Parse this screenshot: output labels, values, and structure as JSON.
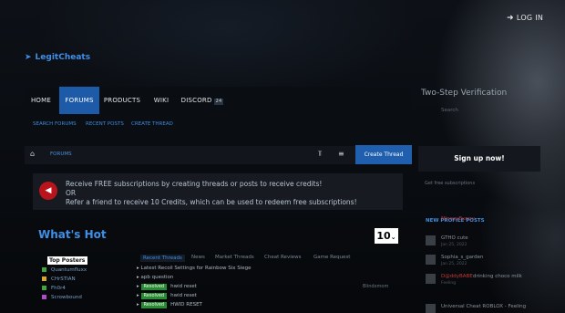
{
  "header": {
    "login_label": "LOG IN",
    "logo_text": "LegitCheats"
  },
  "nav": {
    "items": [
      {
        "label": "HOME"
      },
      {
        "label": "FORUMS"
      },
      {
        "label": "PRODUCTS"
      },
      {
        "label": "WIKI"
      },
      {
        "label": "DISCORD"
      }
    ],
    "discord_tag": "24",
    "active_index": 1
  },
  "subnav": {
    "search": "SEARCH FORUMS",
    "recent": "RECENT POSTS",
    "create": "CREATE THREAD"
  },
  "breadcrumb": {
    "forums": "FORUMS",
    "create_thread_button": "Create Thread"
  },
  "notice": {
    "line1": "Receive FREE subscriptions by creating threads or posts to receive credits!",
    "line2": "OR",
    "line3": "Refer a friend to receive 10 Credits, which can be used to redeem free subscriptions!"
  },
  "whats_hot": {
    "title": "What's Hot",
    "count_select": "10"
  },
  "top_posters": {
    "select_label": "Top Posters",
    "names": [
      "Quantumfluxx",
      "CHrSTIAN",
      "Fh0r4",
      "Scrowbound"
    ]
  },
  "tabs": [
    "Recent Threads",
    "News",
    "Market Threads",
    "Cheat Reviews",
    "Game Request"
  ],
  "threads": [
    {
      "badge": "",
      "title": "Latest Recoil Settings for Rainbow Six Siege",
      "meta": ""
    },
    {
      "badge": "",
      "title": "apb question",
      "meta": ""
    },
    {
      "badge": "Resolved",
      "title": "hwid reset",
      "meta": "Blindxmom"
    },
    {
      "badge": "Resolved",
      "title": "hwid reset",
      "meta": ""
    },
    {
      "badge": "Resolved",
      "title": "HWID RESET",
      "meta": ""
    }
  ],
  "sidebar": {
    "two_step_title": "Two-Step Verification",
    "two_step_sub": "Search",
    "signup_label": "Sign up now!",
    "free_subs_text": "Get free subscriptions",
    "profile_posts_title": "NEW PROFILE POSTS",
    "profile_posts": [
      {
        "name": "MinecyBunny",
        "text": "",
        "time": ""
      },
      {
        "name": "",
        "text": "GTHO cute",
        "time": "Jan 25, 2022"
      },
      {
        "name": "",
        "text": "Sophia_s_garden",
        "time": "Jan 25, 2022"
      },
      {
        "name": "D@ddyBABE",
        "text": "drinking choco milk",
        "time": "Feeling"
      },
      {
        "name": "",
        "text": "Universal Cheat ROBLOX - Feeling",
        "time": ""
      }
    ]
  },
  "colors": {
    "accent": "#1d5aa8",
    "link": "#3f8fe6",
    "resolved": "#2b8a34",
    "notice_badge": "#b9131c"
  }
}
